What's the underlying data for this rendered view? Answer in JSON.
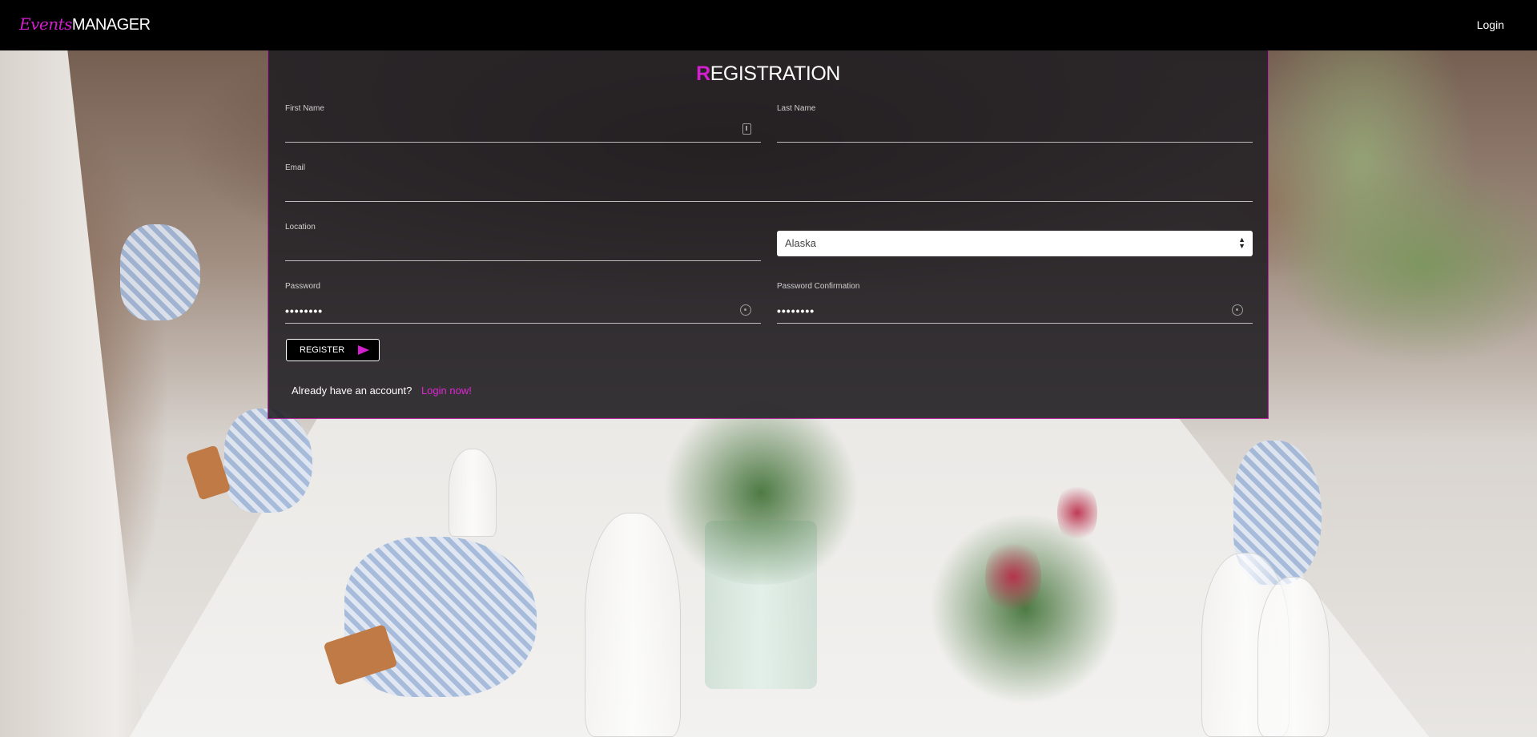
{
  "header": {
    "brand_script": "Events",
    "brand_main": "MANAGER",
    "login_label": "Login"
  },
  "form": {
    "title_first_letter": "R",
    "title_rest": "EGISTRATION",
    "first_name_label": "First Name",
    "last_name_label": "Last Name",
    "email_label": "Email",
    "location_label": "Location",
    "state_value": "Alaska",
    "password_label": "Password",
    "password_value": "••••••••",
    "password_confirmation_label": "Password Confirmation",
    "password_confirmation_value": "••••••••",
    "register_label": "REGISTER",
    "account_prompt": "Already have an account?",
    "login_now_label": "Login now!"
  },
  "colors": {
    "accent": "#d41fcf",
    "header_bg": "#000000",
    "panel_bg": "#201e22"
  },
  "icons": {
    "first_name": "id-card-icon",
    "password": "eye-icon",
    "password_confirmation": "eye-icon",
    "register": "send-icon",
    "select": "sort-arrows-icon"
  }
}
